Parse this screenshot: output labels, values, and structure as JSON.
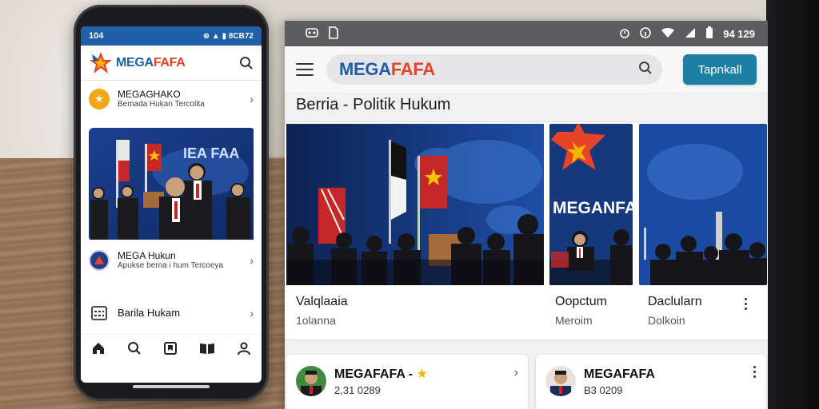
{
  "phone": {
    "status_time": "104",
    "status_right": "⊗ ▲ ▮ 8CB72",
    "brand_mega": "MEGA",
    "brand_fa": "FAFA",
    "rows": [
      {
        "title": "MEGAGHAKO",
        "subtitle": "Bemada Hukan Tercolita"
      },
      {
        "title": "MEGA Hukun",
        "subtitle": "Apukse berna i hum Tercoeya"
      },
      {
        "title": "Barila Hukam",
        "subtitle": ""
      }
    ],
    "image_banner": "IEA FAA"
  },
  "tablet": {
    "status_time": "94 129",
    "brand_mega": "MEGA",
    "brand_fa": "FAFA",
    "cta_label": "Tapnkall",
    "section_title": "Berria - Politik Hukum",
    "mini1_banner": "MEGANFA",
    "cards": [
      {
        "title": "Valqlaaia",
        "subtitle": "1olanna"
      },
      {
        "title": "Oopctum",
        "subtitle": "Meroim"
      },
      {
        "title": "Daclularn",
        "subtitle": "Dolkoin"
      }
    ],
    "news": [
      {
        "title": "MEGAFAFA -",
        "date": "2,31 0289"
      },
      {
        "title": "MEGAFAFA",
        "date": "B3 0209"
      }
    ]
  },
  "colors": {
    "brand_blue": "#1f5fa8",
    "brand_orange": "#e8442a",
    "cta": "#1c7fa3"
  },
  "icons": {
    "phone_nav": [
      "home-icon",
      "search-icon",
      "bookmark-icon",
      "library-icon",
      "profile-icon"
    ]
  }
}
